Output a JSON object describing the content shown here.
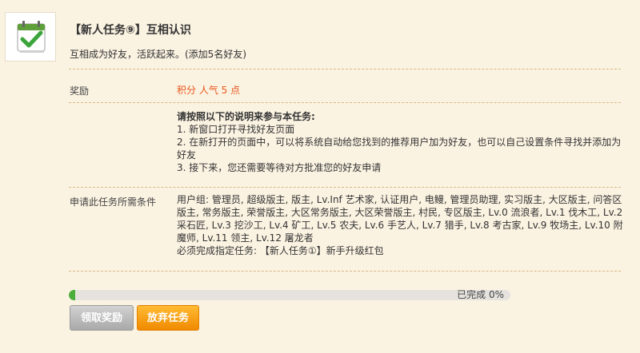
{
  "task": {
    "title": "【新人任务⑨】互相认识",
    "description": "互相成为好友，活跃起来。(添加5名好友)",
    "icon": "calendar-check-icon"
  },
  "reward": {
    "label": "奖励",
    "value": "积分 人气 5 点"
  },
  "instructions": {
    "heading": "请按照以下的说明来参与本任务:",
    "steps": [
      "1. 新窗口打开寻找好友页面",
      "2. 在新打开的页面中，可以将系统自动给您找到的推荐用户加为好友，也可以自己设置条件寻找并添加为好友",
      "3. 接下来，您还需要等待对方批准您的好友申请"
    ]
  },
  "conditions": {
    "label": "申请此任务所需条件",
    "user_groups": "用户组: 管理员, 超级版主, 版主, Lv.Inf 艺术家, 认证用户, 电鳗, 管理员助理, 实习版主, 大区版主, 问答区版主, 常务版主, 荣誉版主, 大区常务版主, 大区荣誉版主, 村民, 专区版主, Lv.0 流浪者, Lv.1 伐木工, Lv.2 采石匠, Lv.3 挖沙工, Lv.4 矿工, Lv.5 农夫, Lv.6 手艺人, Lv.7 猎手, Lv.8 考古家, Lv.9 牧场主, Lv.10 附魔师, Lv.11 领主, Lv.12 屠龙者",
    "prerequisite": "必须完成指定任务: 【新人任务①】新手升级红包"
  },
  "progress": {
    "text": "已完成 0%",
    "value": 0
  },
  "buttons": {
    "claim": "领取奖励",
    "abandon": "放弃任务"
  },
  "colors": {
    "background": "#fbf3e2",
    "reward_text": "#e8541e",
    "progress_fill": "#4cae3a",
    "abandon_button": "#f59a0c",
    "claim_button_disabled": "#b8b8b8"
  }
}
